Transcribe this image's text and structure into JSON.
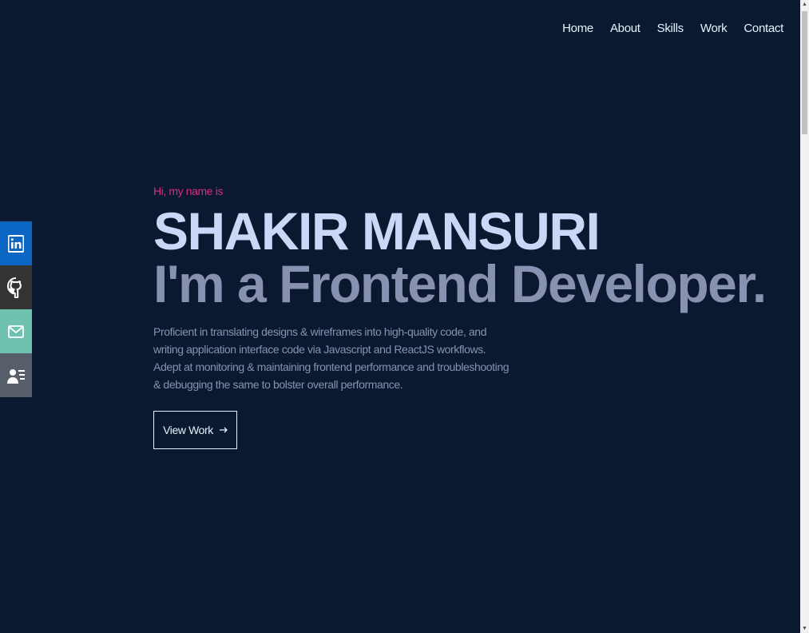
{
  "nav": {
    "items": [
      {
        "label": "Home"
      },
      {
        "label": "About"
      },
      {
        "label": "Skills"
      },
      {
        "label": "Work"
      },
      {
        "label": "Contact"
      }
    ]
  },
  "social": {
    "items": [
      {
        "icon": "linkedin-icon",
        "color": "#0a66c2"
      },
      {
        "icon": "github-icon",
        "color": "#333333"
      },
      {
        "icon": "email-icon",
        "color": "#6fc2b0"
      },
      {
        "icon": "resume-icon",
        "color": "#565f69"
      }
    ]
  },
  "hero": {
    "greeting": "Hi, my name is",
    "name": "SHAKIR MANSURI",
    "tagline": "I'm a Frontend Developer.",
    "description": "Proficient in translating designs & wireframes into high-quality code, and writing application interface code via Javascript and ReactJS workflows. Adept at monitoring & maintaining frontend performance and troubleshooting & debugging the same to bolster overall performance.",
    "button_label": "View Work"
  },
  "colors": {
    "background": "#0a192f",
    "accent": "#e0287a",
    "heading": "#ccd6f6",
    "muted": "#8892b0"
  }
}
